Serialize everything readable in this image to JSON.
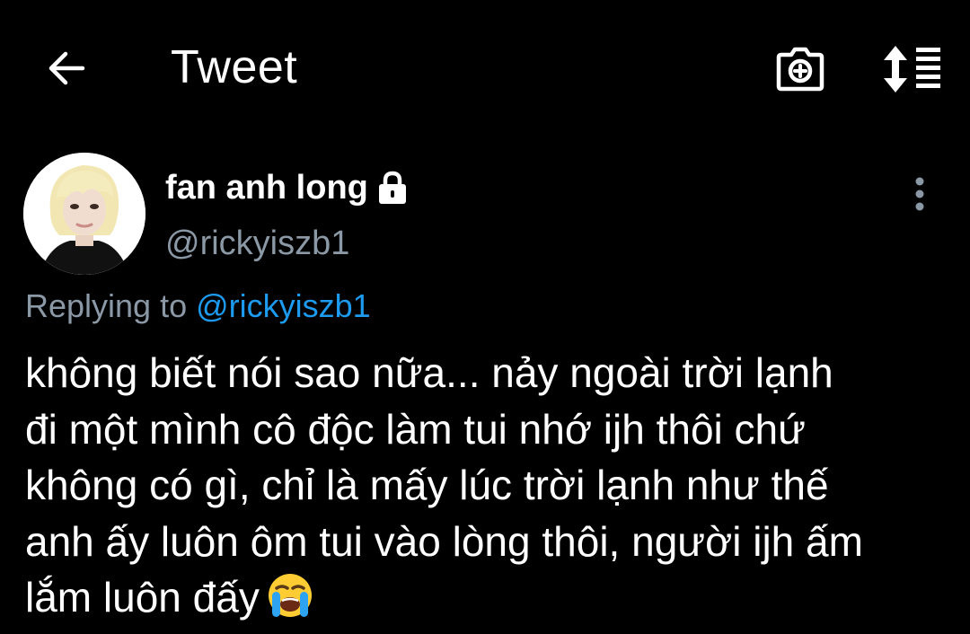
{
  "header": {
    "title": "Tweet",
    "back_icon": "arrow-left-icon",
    "camera_icon": "camera-add-icon",
    "sort_icon": "sort-list-icon"
  },
  "author": {
    "name": "fan anh long",
    "handle": "@rickyiszb1",
    "protected_icon": "lock-icon",
    "more_icon": "more-vertical-icon"
  },
  "reply": {
    "prefix": "Replying to",
    "mention": "@rickyiszb1"
  },
  "tweet": {
    "lines": [
      "không biết nói sao nữa... nảy ngoài trời lạnh",
      "đi một mình cô độc làm tui nhớ ijh thôi chứ",
      "không có gì, chỉ là mấy lúc trời lạnh như thế",
      "anh ấy luôn ôm tui vào lòng thôi, người ijh ấm",
      "lắm luôn đấy"
    ],
    "emoji": "loudly-crying-face-emoji"
  },
  "colors": {
    "background": "#000000",
    "text": "#ffffff",
    "secondary": "#8b98a5",
    "link": "#1d9bf0"
  }
}
